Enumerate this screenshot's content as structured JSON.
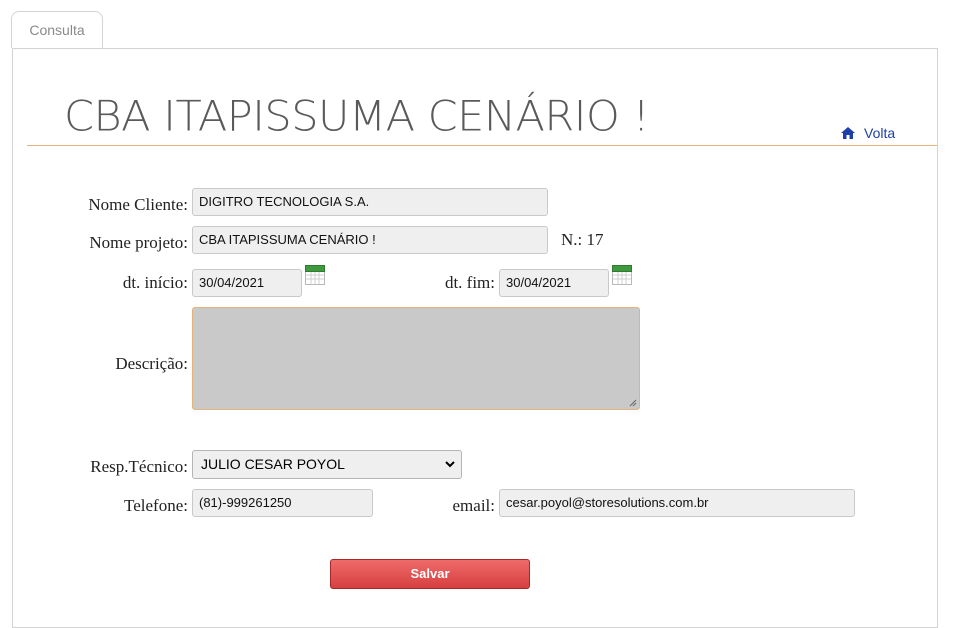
{
  "tab": {
    "label": "Consulta"
  },
  "header": {
    "title": "CBA ITAPISSUMA CENÁRIO !",
    "back_label": "Volta"
  },
  "form": {
    "nome_cliente": {
      "label": "Nome Cliente:",
      "value": "DIGITRO TECNOLOGIA S.A."
    },
    "nome_projeto": {
      "label": "Nome projeto:",
      "value": "CBA ITAPISSUMA CENÁRIO !"
    },
    "numero": {
      "label": "N.: 17"
    },
    "dt_inicio": {
      "label": "dt. início:",
      "value": "30/04/2021"
    },
    "dt_fim": {
      "label": "dt. fim:",
      "value": "30/04/2021"
    },
    "descricao": {
      "label": "Descrição:",
      "value": ""
    },
    "resp_tecnico": {
      "label": "Resp.Técnico:",
      "selected": "JULIO CESAR POYOL"
    },
    "telefone": {
      "label": "Telefone:",
      "value": "(81)-999261250"
    },
    "email": {
      "label": "email:",
      "value": "cesar.poyol@storesolutions.com.br"
    },
    "save_label": "Salvar"
  },
  "colors": {
    "accent_rule": "#e2b37c",
    "link": "#1f3fa8",
    "save_button": "#d63f3f"
  },
  "icons": {
    "home": "home-icon",
    "calendar": "calendar-icon",
    "dropdown": "chevron-down-icon"
  }
}
